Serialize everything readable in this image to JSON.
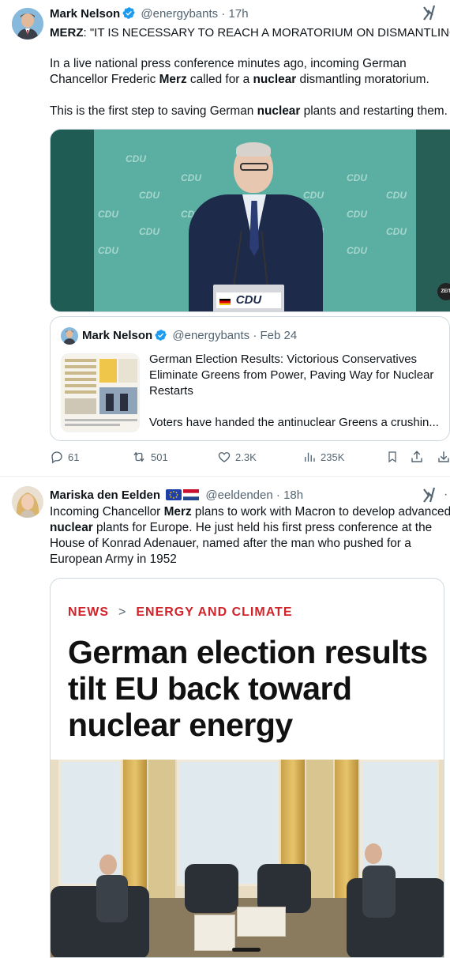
{
  "tweet1": {
    "name": "Mark Nelson",
    "handle": "@energybants",
    "time": "17h",
    "line1_bold": "MERZ",
    "line1_rest": ": \"IT IS NECESSARY TO REACH A MORATORIUM ON DISMANTLING\"",
    "para2_a": "In a live national press conference minutes ago, incoming German",
    "para2_b": "Chancellor Frederic ",
    "para2_merz": "Merz",
    "para2_c": " called for a ",
    "para2_nuclear": "nuclear",
    "para2_d": " dismantling moratorium.",
    "para3_a": "This is the first step to saving German ",
    "para3_nuclear": "nuclear",
    "para3_b": " plants and restarting them.",
    "media": {
      "bg_label": "CDU",
      "podium_label": "CDU",
      "watermark": "ZEIT"
    },
    "quote": {
      "name": "Mark Nelson",
      "handle": "@energybants",
      "date": "Feb 24",
      "title": "German Election Results: Victorious Conservatives Eliminate Greens from Power, Paving Way for Nuclear Restarts",
      "snippet": "Voters have handed the antinuclear Greens a crushin..."
    },
    "actions": {
      "replies": "61",
      "reposts": "501",
      "likes": "2.3K",
      "views": "235K"
    }
  },
  "tweet2": {
    "name": "Mariska den Eelden",
    "handle": "@eeldenden",
    "time": "18h",
    "line1_a": "Incoming Chancellor ",
    "line1_merz": "Merz",
    "line1_b": " plans to work with Macron to develop advanced",
    "line2_nuclear": "nuclear",
    "line2_b": " plants for Europe. He just held his first press conference at the",
    "line3": "House of Konrad Adenauer, named after the man who pushed for a",
    "line4": "European Army in 1952",
    "article": {
      "crumb1": "NEWS",
      "crumb_sep": ">",
      "crumb2": "ENERGY AND CLIMATE",
      "headline_1": "German election results",
      "headline_2": "tilt EU back toward",
      "headline_3": "nuclear energy"
    }
  },
  "colors": {
    "text": "#0f1419",
    "muted": "#536471",
    "verified": "#1d9bf0",
    "accent_red": "#d0232a",
    "cdu_green": "#5aaea2"
  }
}
